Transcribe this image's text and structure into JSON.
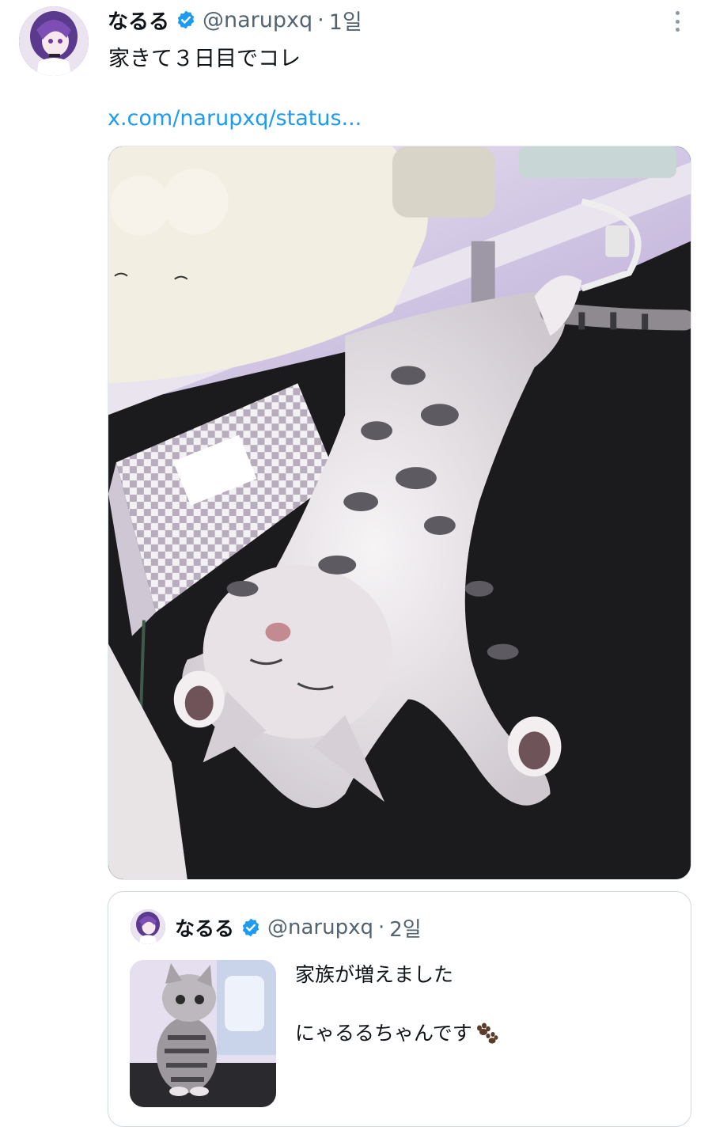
{
  "tweet": {
    "author": {
      "name": "なるる",
      "handle": "@narupxq",
      "verified": true,
      "avatar_icon": "user-avatar-anime"
    },
    "separator": "·",
    "time": "1일",
    "text": "家きて３日目でコレ",
    "link_text": "x.com/narupxq/status...",
    "media_description_icon": "photo-kitten-sleeping",
    "more_icon": "more-vertical-icon"
  },
  "quoted_tweet": {
    "author": {
      "name": "なるる",
      "handle": "@narupxq",
      "verified": true
    },
    "separator": "·",
    "time": "2일",
    "text_line_1": "家族が増えました",
    "text_line_2": "にゃるるちゃんです",
    "emoji_icon": "paw-prints-icon"
  },
  "colors": {
    "link": "#1d9bf0",
    "secondary_text": "#536471",
    "verified_badge": "#1d9bf0",
    "border": "#cfd9de"
  }
}
